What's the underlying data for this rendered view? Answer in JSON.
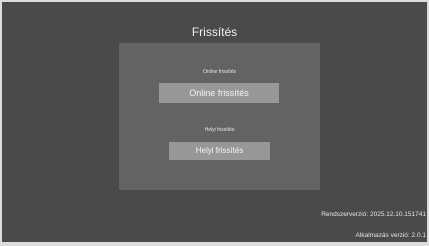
{
  "window": {
    "title": "Frissítés"
  },
  "panel": {
    "online_section_label": "Online frissítés",
    "online_button_label": "Online frissítés",
    "local_section_label": "Helyi frissítés",
    "local_button_label": "Helyi frissítés"
  },
  "footer": {
    "system_version": "Rendszerverzió: 2025.12.10.151741",
    "app_version": "Alkalmazás verzió: 2.0.1"
  },
  "colors": {
    "background": "#4a4a4a",
    "panel": "#636363",
    "button": "#979797",
    "text": "#f2f2f2"
  }
}
